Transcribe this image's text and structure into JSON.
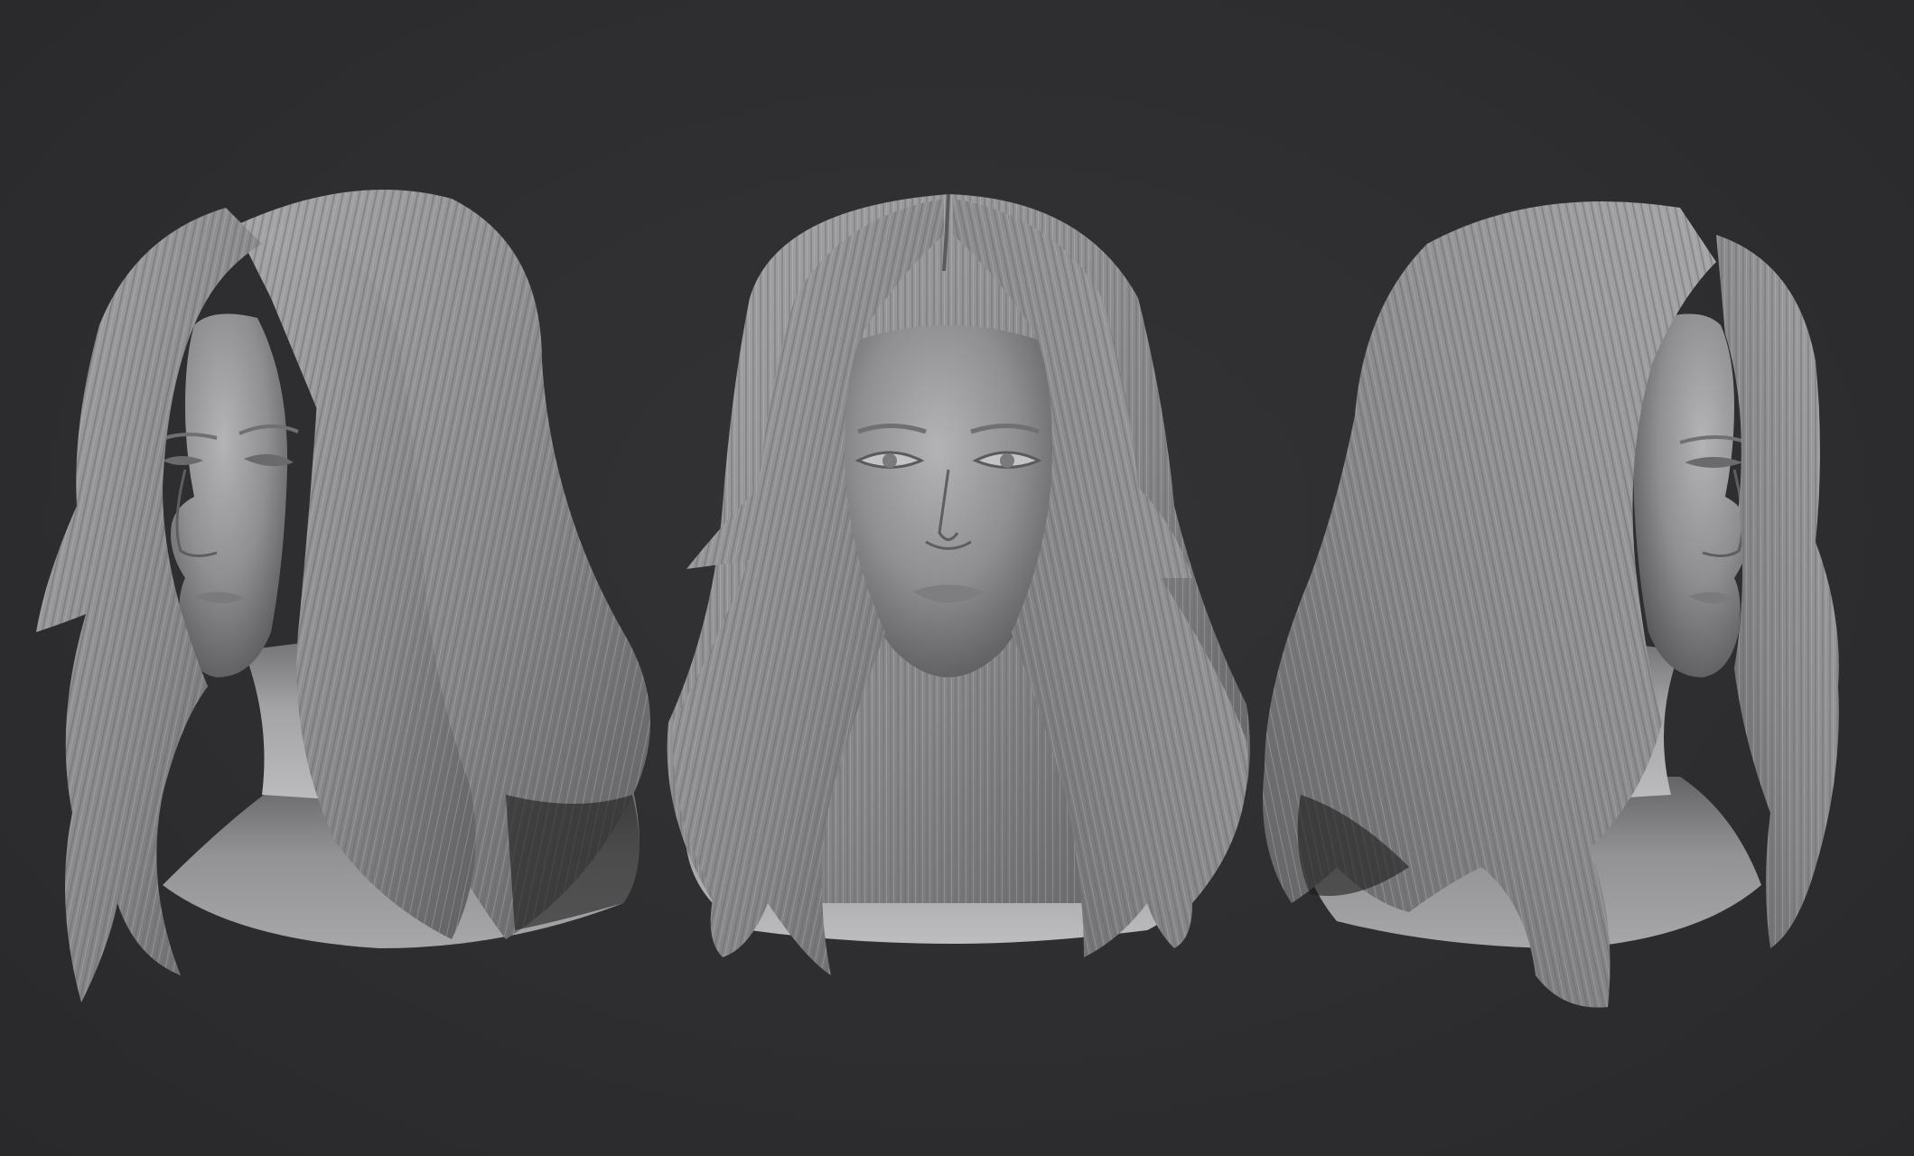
{
  "scene": {
    "description_free": true,
    "background_color": "#2e2e30",
    "clay_color": "#9a9a9c",
    "shadow_color": "#1a1a1b",
    "views": [
      {
        "name": "three-quarter-left-view"
      },
      {
        "name": "front-view"
      },
      {
        "name": "three-quarter-right-view"
      }
    ]
  }
}
